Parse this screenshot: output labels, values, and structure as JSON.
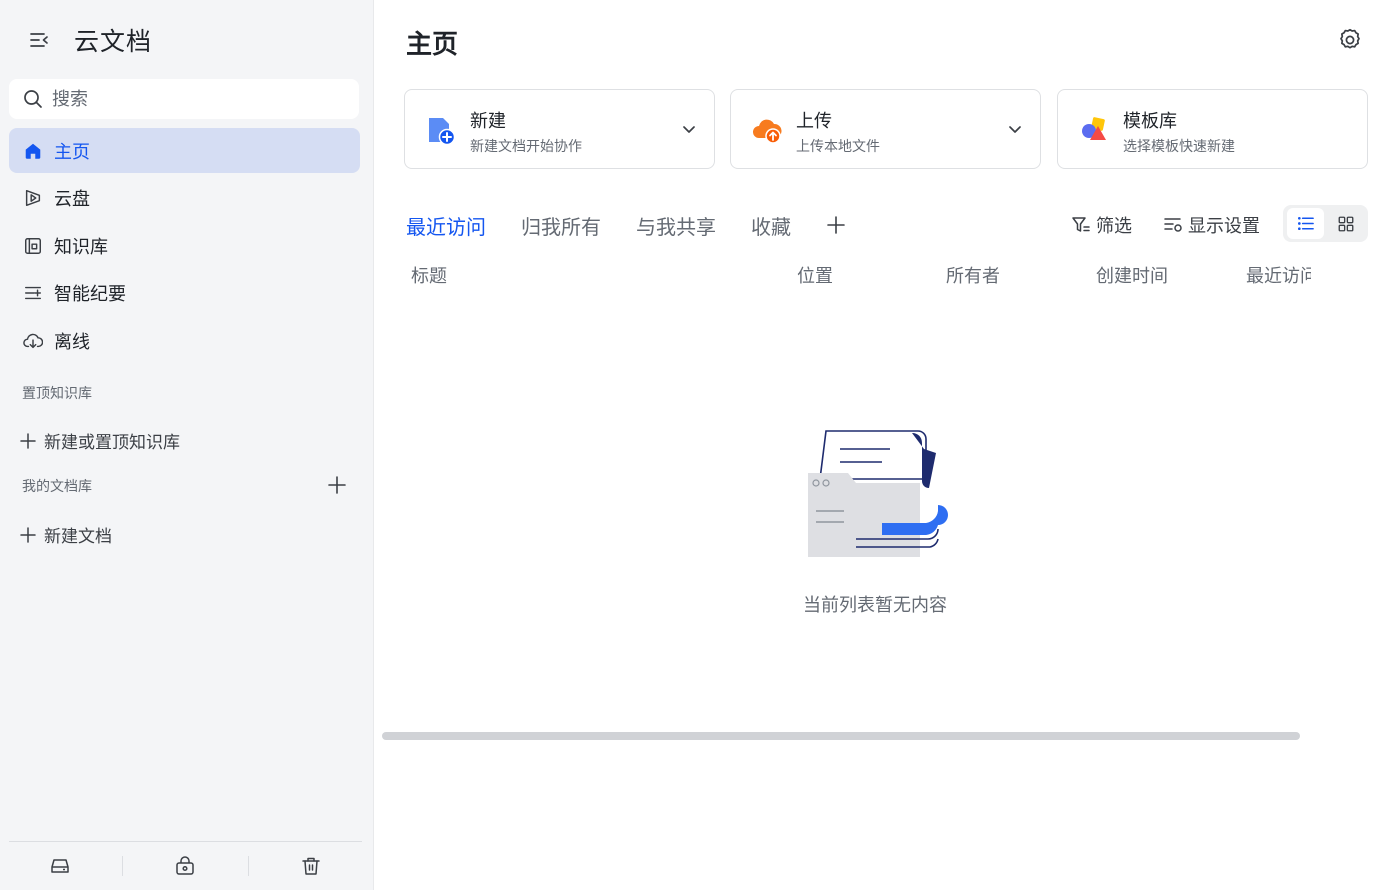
{
  "sidebar": {
    "app_title": "云文档",
    "search_placeholder": "搜索",
    "nav": [
      {
        "label": "主页",
        "icon": "home-icon",
        "active": true
      },
      {
        "label": "云盘",
        "icon": "cloud-drive-icon"
      },
      {
        "label": "知识库",
        "icon": "wiki-icon"
      },
      {
        "label": "智能纪要",
        "icon": "smart-minutes-icon"
      },
      {
        "label": "离线",
        "icon": "offline-download-icon"
      }
    ],
    "pinned_section": "置顶知识库",
    "pinned_add": "新建或置顶知识库",
    "my_library_section": "我的文档库",
    "my_library_add": "新建文档",
    "footer_icons": [
      "storage-icon",
      "lock-box-icon",
      "trash-icon"
    ]
  },
  "main": {
    "title": "主页",
    "cards": [
      {
        "title": "新建",
        "subtitle": "新建文档开始协作",
        "icon": "new-doc-icon"
      },
      {
        "title": "上传",
        "subtitle": "上传本地文件",
        "icon": "upload-cloud-icon"
      },
      {
        "title": "模板库",
        "subtitle": "选择模板快速新建",
        "icon": "template-shapes-icon"
      }
    ],
    "tabs": [
      "最近访问",
      "归我所有",
      "与我共享",
      "收藏"
    ],
    "active_tab": "最近访问",
    "filter_label": "筛选",
    "display_settings_label": "显示设置",
    "columns": [
      "标题",
      "位置",
      "所有者",
      "创建时间",
      "最近访问"
    ],
    "empty_text": "当前列表暂无内容",
    "view_mode": "list"
  },
  "colors": {
    "accent": "#1456f0",
    "active_nav_bg": "#d5ddf3",
    "upload_orange": "#f77b1f",
    "sidebar_bg": "#f4f5f7"
  }
}
